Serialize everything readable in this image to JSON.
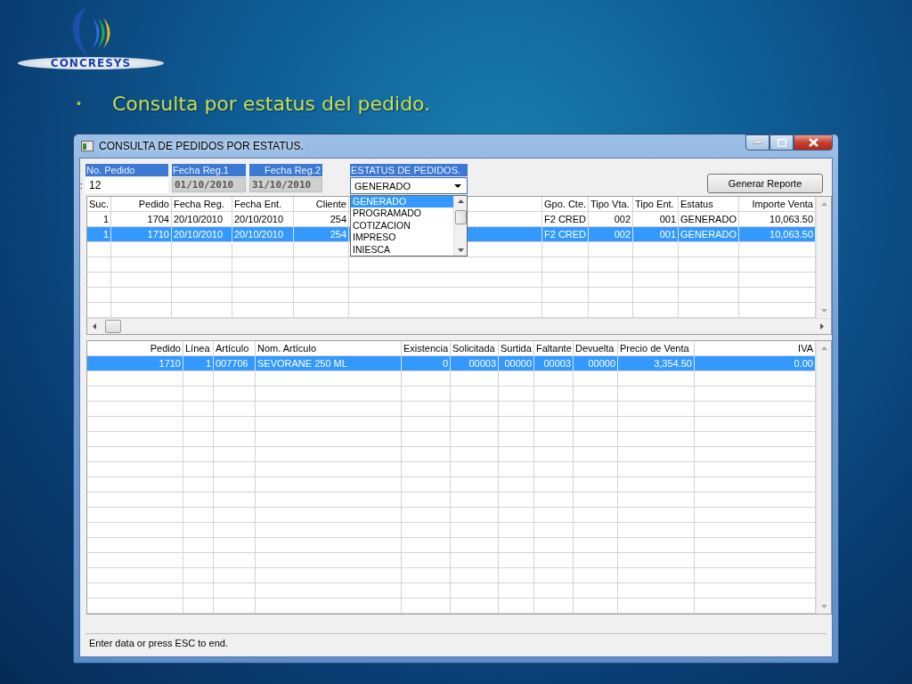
{
  "slide": {
    "logo_text": "CONCRESYS",
    "bullet": "•",
    "title": "Consulta por estatus del pedido."
  },
  "window": {
    "title": "CONSULTA DE PEDIDOS POR ESTATUS."
  },
  "filters": {
    "order_label": "No. Pedido",
    "order_prefix": ":",
    "order_value": "12",
    "date1_label": "Fecha Reg.1",
    "date1_value": "01/10/2010",
    "date2_label": "Fecha Reg.2",
    "date2_value": "31/10/2010"
  },
  "status_filter": {
    "label": "ESTATUS DE PEDIDOS.",
    "value": "GENERADO",
    "expanded": true,
    "options": [
      {
        "label": "GENERADO",
        "selected": true
      },
      {
        "label": "PROGRAMADO",
        "selected": false
      },
      {
        "label": "COTIZACION",
        "selected": false
      },
      {
        "label": "IMPRESO",
        "selected": false
      },
      {
        "label": "INIESCA",
        "selected": false
      }
    ]
  },
  "report_button": "Generar Reporte",
  "orders_table": {
    "columns": [
      "Suc.",
      "Pedido",
      "Fecha Reg.",
      "Fecha Ent.",
      "Cliente",
      "Gpo. Cte.",
      "Tipo Vta.",
      "Tipo Ent.",
      "Estatus",
      "Importe Venta"
    ],
    "rows": [
      {
        "selected": false,
        "cells": [
          "1",
          "1704",
          "20/10/2010",
          "20/10/2010",
          "254",
          "F2 CRED",
          "002",
          "001",
          "GENERADO",
          "10,063.50"
        ]
      },
      {
        "selected": true,
        "cells": [
          "1",
          "1710",
          "20/10/2010",
          "20/10/2010",
          "254",
          "F2 CRED",
          "002",
          "001",
          "GENERADO",
          "10,063.50"
        ]
      }
    ]
  },
  "lines_table": {
    "columns": [
      "Pedido",
      "Línea",
      "Artículo",
      "Nom. Artículo",
      "Existencia",
      "Solicitada",
      "Surtida",
      "Faltante",
      "Devuelta",
      "Precio de Venta",
      "IVA"
    ],
    "rows": [
      {
        "selected": true,
        "cells": [
          "1710",
          "1",
          "007706",
          "SEVORANE 250 ML",
          "0",
          "00003",
          "00000",
          "00003",
          "00000",
          "3,354.50",
          "0.00"
        ]
      }
    ]
  },
  "status_bar": "Enter data or press ESC to end."
}
